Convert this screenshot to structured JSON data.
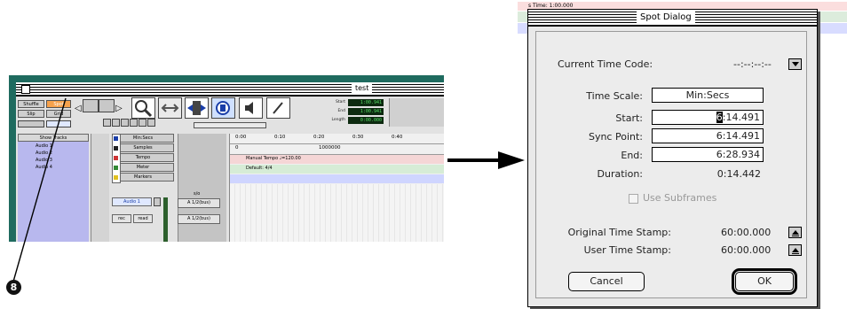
{
  "edit_window": {
    "title": "test",
    "edit_modes": [
      "Shuffle",
      "Spot",
      "Slip",
      "Grid"
    ],
    "counters": [
      {
        "label": "Start",
        "value": "1:00.941"
      },
      {
        "label": "End",
        "value": "1:00.941"
      },
      {
        "label": "Length",
        "value": "0:00.000"
      }
    ],
    "show_tracks_label": "Show Tracks",
    "tracks": [
      "Audio 1",
      "Audio 2",
      "Audio 3",
      "Audio 4"
    ],
    "ruler_buttons": [
      "Min:Secs",
      "Samples",
      "Tempo",
      "Meter",
      "Markers"
    ],
    "track_name_popup": "Audio 1",
    "ruler_ticks": [
      "0:00",
      "0:10",
      "0:20",
      "0:30",
      "0:40"
    ],
    "samples_value": "1000000",
    "tempo_text": "Manual Tempo ♩=120.00",
    "meter_text": "Default: 4/4",
    "small_buttons": [
      "rec",
      "read"
    ],
    "io_label": "s/o",
    "track_io": [
      "A 1/2(bus)",
      "A 1/2(bus)"
    ]
  },
  "callout_number": "8",
  "background_window": {
    "title_text": "Spot Dialog",
    "label": "s Time: 1:00.000"
  },
  "spot_dialog": {
    "title": "Spot Dialog",
    "current_time_code_label": "Current Time Code:",
    "current_time_code_value": "--:--:--:--",
    "time_scale_label": "Time Scale:",
    "time_scale_value": "Min:Secs",
    "start_label": "Start:",
    "start_value": "6:14.491",
    "sync_point_label": "Sync Point:",
    "sync_point_value": "6:14.491",
    "end_label": "End:",
    "end_value": "6:28.934",
    "duration_label": "Duration:",
    "duration_value": "0:14.442",
    "use_subframes_label": "Use Subframes",
    "original_time_stamp_label": "Original Time Stamp:",
    "original_time_stamp_value": "60:00.000",
    "user_time_stamp_label": "User Time Stamp:",
    "user_time_stamp_value": "60:00.000",
    "cancel_label": "Cancel",
    "ok_label": "OK"
  },
  "colors": {
    "window_border": "#1f6b5f",
    "track_list": "#b8b8ee",
    "tempo_ruler": "#f5d6d6",
    "meter_ruler": "#d6ecd6",
    "mode_selected": "#f7a24c",
    "counter_bg": "#0d2a10",
    "counter_fg": "#58e068"
  }
}
